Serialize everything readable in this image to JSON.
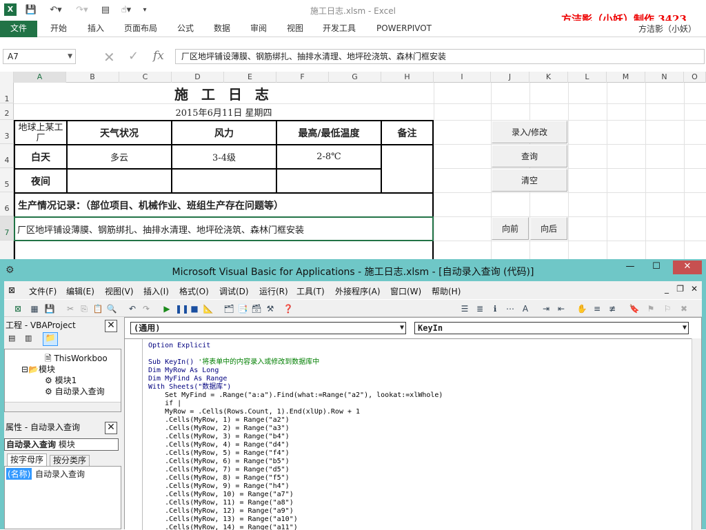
{
  "excel": {
    "window_title": "施工日志.xlsm - Excel",
    "watermark": "方洁影（小妖）制作 3423",
    "user": "方洁影（小妖）",
    "tabs": [
      "文件",
      "开始",
      "插入",
      "页面布局",
      "公式",
      "数据",
      "审阅",
      "视图",
      "开发工具",
      "POWERPIVOT"
    ],
    "name_box": "A7",
    "formula_value": "厂区地坪铺设薄膜、钢筋绑扎、抽排水清理、地坪砼浇筑、森林门框安装",
    "columns": [
      "A",
      "B",
      "C",
      "D",
      "E",
      "F",
      "G",
      "H",
      "I",
      "J",
      "K",
      "L",
      "M",
      "N",
      "O"
    ],
    "rows": [
      "1",
      "2",
      "3",
      "4",
      "5",
      "6",
      "7"
    ],
    "sheet": {
      "title": "施 工 日 志",
      "date": "2015年6月11日 星期四",
      "site": "地球上某工厂",
      "headers": {
        "weather": "天气状况",
        "wind": "风力",
        "temp": "最高/最低温度",
        "remark": "备注"
      },
      "day_label": "白天",
      "night_label": "夜间",
      "day_weather": "多云",
      "day_wind": "3-4级",
      "day_temp": "2-8℃",
      "production_label": "生产情况记录：（部位项目、机械作业、班组生产存在问题等）",
      "production_value": "厂区地坪铺设薄膜、钢筋绑扎、抽排水清理、地坪砼浇筑、森林门框安装"
    },
    "buttons": {
      "entry": "录入/修改",
      "query": "查询",
      "clear": "清空",
      "prev": "向前",
      "next": "向后"
    }
  },
  "vbe": {
    "title": "Microsoft Visual Basic for Applications - 施工日志.xlsm - [自动录入查询 (代码)]",
    "menus": [
      "文件(F)",
      "编辑(E)",
      "视图(V)",
      "插入(I)",
      "格式(O)",
      "调试(D)",
      "运行(R)",
      "工具(T)",
      "外接程序(A)",
      "窗口(W)",
      "帮助(H)"
    ],
    "project_pane_title": "工程 - VBAProject",
    "tree": [
      "ThisWorkboo",
      "模块",
      "模块1",
      "自动录入查询"
    ],
    "props_pane_title": "属性 - 自动录入查询",
    "props_object": "自动录入查询",
    "props_type": "模块",
    "props_tabs": [
      "按字母序",
      "按分类序"
    ],
    "props_name_key": "(名称)",
    "props_name_value": "自动录入查询",
    "object_combo": "(通用)",
    "proc_combo": "KeyIn",
    "code_lines": [
      "Option Explicit",
      "",
      "Sub KeyIn() '将表单中的内容录入或修改到数据库中",
      "Dim MyRow As Long",
      "Dim MyFind As Range",
      "With Sheets(\"数据库\")",
      "    Set MyFind = .Range(\"a:a\").Find(what:=Range(\"a2\"), lookat:=xlWhole)",
      "    if |",
      "    MyRow = .Cells(Rows.Count, 1).End(xlUp).Row + 1",
      "    .Cells(MyRow, 1) = Range(\"a2\")",
      "    .Cells(MyRow, 2) = Range(\"a3\")",
      "    .Cells(MyRow, 3) = Range(\"b4\")",
      "    .Cells(MyRow, 4) = Range(\"d4\")",
      "    .Cells(MyRow, 5) = Range(\"f4\")",
      "    .Cells(MyRow, 6) = Range(\"b5\")",
      "    .Cells(MyRow, 7) = Range(\"d5\")",
      "    .Cells(MyRow, 8) = Range(\"f5\")",
      "    .Cells(MyRow, 9) = Range(\"h4\")",
      "    .Cells(MyRow, 10) = Range(\"a7\")",
      "    .Cells(MyRow, 11) = Range(\"a8\")",
      "    .Cells(MyRow, 12) = Range(\"a9\")",
      "    .Cells(MyRow, 13) = Range(\"a10\")",
      "    .Cells(MyRow, 14) = Range(\"a11\")"
    ]
  }
}
